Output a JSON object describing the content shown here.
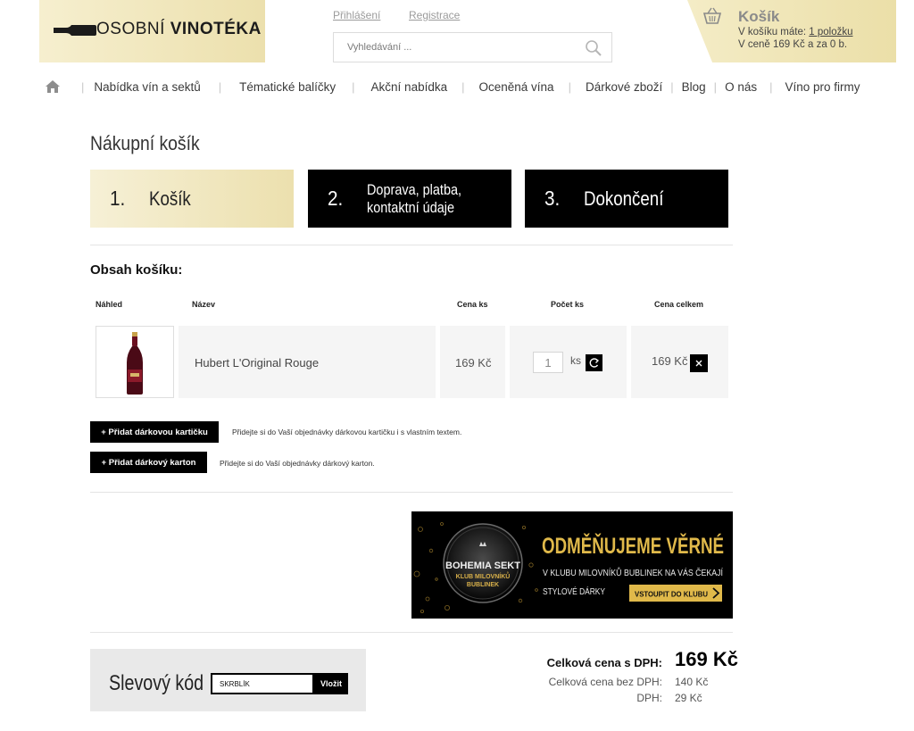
{
  "header": {
    "logo_part1": "OSOBNÍ ",
    "logo_part2": "VINOTÉKA",
    "login_link": "Přihlášení",
    "register_link": "Registrace",
    "search_placeholder": "Vyhledávání ..."
  },
  "mini_cart": {
    "title": "Košík",
    "line1_prefix": "V košíku máte: ",
    "line1_link": "1 položku",
    "line2": "V ceně 169 Kč a za 0 b."
  },
  "nav": {
    "items": [
      "Nabídka vín a sektů",
      "Tématické balíčky",
      "Akční nabídka",
      "Oceněná vína",
      "Dárkové zboží",
      "Blog",
      "O nás",
      "Víno pro firmy"
    ]
  },
  "page_title": "Nákupní košík",
  "steps": [
    {
      "num": "1.",
      "label": "Košík"
    },
    {
      "num": "2.",
      "label": "Doprava, platba, kontaktní údaje"
    },
    {
      "num": "3.",
      "label": "Dokončení"
    }
  ],
  "cart": {
    "title": "Obsah košíku:",
    "headers": {
      "preview": "Náhled",
      "name": "Název",
      "unit_price": "Cena ks",
      "quantity": "Počet ks",
      "total": "Cena celkem"
    },
    "item": {
      "name": "Hubert L'Original Rouge",
      "unit_price": "169 Kč",
      "quantity": "1",
      "unit": "ks",
      "total": "169 Kč"
    }
  },
  "extras": {
    "gift_card_button": "+ Přidat dárkovou kartičku",
    "gift_card_text": "Přidejte si do Vaší objednávky dárkovou kartičku i s vlastním textem.",
    "gift_box_button": "+ Přidat dárkový karton",
    "gift_box_text": "Přidejte si do Vaší objednávky dárkový karton."
  },
  "banner": {
    "brand_line1": "BOHEMIA SEKT",
    "brand_line2": "KLUB MILOVNÍKŮ",
    "brand_line3": "BUBLINEK",
    "headline": "ODMĚŇUJEME VĚRNÉ",
    "sub1": "V KLUBU MILOVNÍKŮ BUBLINEK NA VÁS ČEKAJÍ",
    "sub2": "STYLOVÉ DÁRKY",
    "cta": "VSTOUPIT DO KLUBU"
  },
  "discount": {
    "label": "Slevový kód",
    "value": "SKRBLÍK",
    "button": "Vložit"
  },
  "summary": {
    "total_label": "Celková cena s DPH:",
    "total_value": "169 Kč",
    "net_label": "Celková cena bez DPH:",
    "net_value": "140 Kč",
    "vat_label": "DPH:",
    "vat_value": "29 Kč"
  },
  "colors": {
    "gold_light": "#f6efcf",
    "gold": "#ece0ad",
    "black": "#000000",
    "banner_gold": "#e0b94a"
  }
}
